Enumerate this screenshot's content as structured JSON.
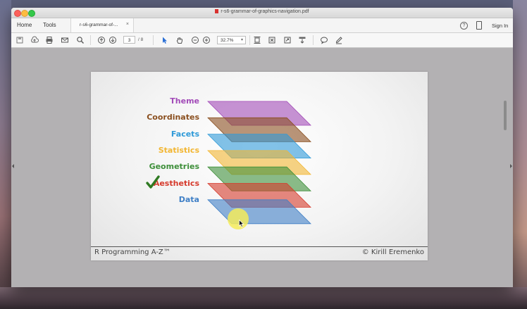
{
  "window": {
    "title": "r-s6-grammar-of-graphics-navigation.pdf"
  },
  "tabs": {
    "home": "Home",
    "tools": "Tools",
    "document": "r-s6-grammar-of-...",
    "close": "×",
    "sign_in": "Sign In"
  },
  "toolbar": {
    "page_current": "3",
    "page_total": "/ 8",
    "zoom": "32.7%"
  },
  "slide": {
    "layers": [
      {
        "label": "Theme",
        "color": "#a24bb8"
      },
      {
        "label": "Coordinates",
        "color": "#8a4f1f"
      },
      {
        "label": "Facets",
        "color": "#2f9ad8"
      },
      {
        "label": "Statistics",
        "color": "#f2b632"
      },
      {
        "label": "Geometries",
        "color": "#3e8f3a"
      },
      {
        "label": "Aesthetics",
        "color": "#d63a2c"
      },
      {
        "label": "Data",
        "color": "#3f7fc6"
      }
    ],
    "checked_layer": "Aesthetics",
    "footer_left": "R Programming A-Z™",
    "footer_right": "© Kirill Eremenko"
  },
  "icons": [
    "save-icon",
    "upload-icon",
    "print-icon",
    "email-icon",
    "search-icon",
    "page-up-icon",
    "page-down-icon",
    "select-cursor-icon",
    "hand-icon",
    "zoom-out-icon",
    "zoom-in-icon",
    "fit-page-icon",
    "crop-icon",
    "fullscreen-icon",
    "download-icon",
    "comment-icon",
    "pen-icon",
    "help-icon",
    "mobile-icon"
  ]
}
